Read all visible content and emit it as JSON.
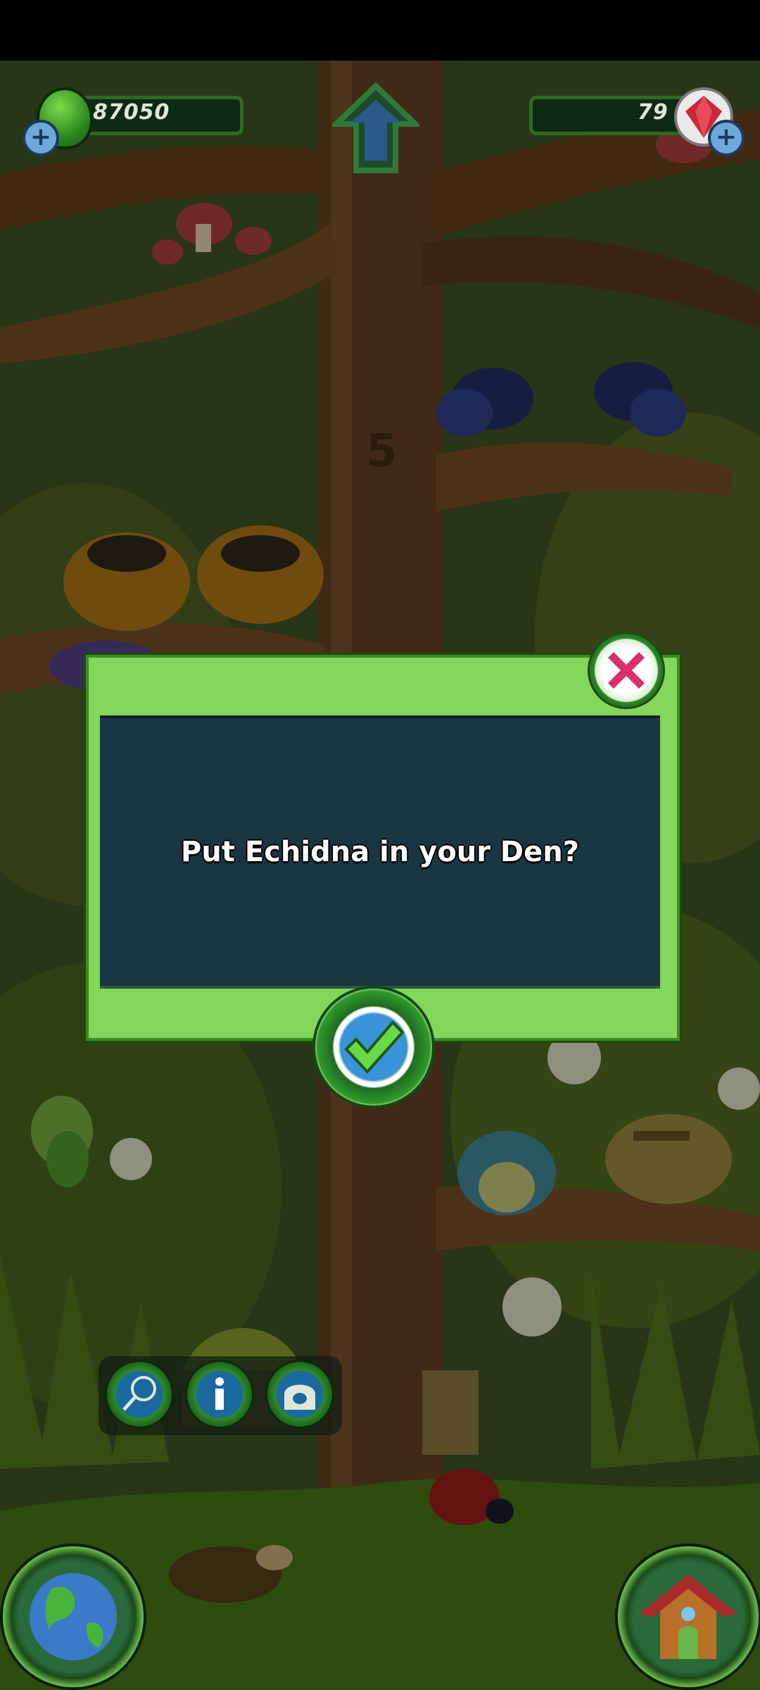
{
  "hud": {
    "coins": "87050",
    "gems": "79"
  },
  "dialog": {
    "message": "Put Echidna in your Den?"
  },
  "icons": {
    "coin": "green-coin-icon",
    "gem": "red-gem-icon",
    "home": "home-arrow-icon",
    "close": "close-x-icon",
    "confirm": "checkmark-icon",
    "net": "net-icon",
    "info": "info-icon",
    "den": "den-icon",
    "world": "globe-icon",
    "house": "house-icon"
  },
  "colors": {
    "dialog_frame": "#82d65a",
    "dialog_panel": "#193642",
    "close_x": "#d8306a",
    "check": "#6ad84a"
  }
}
